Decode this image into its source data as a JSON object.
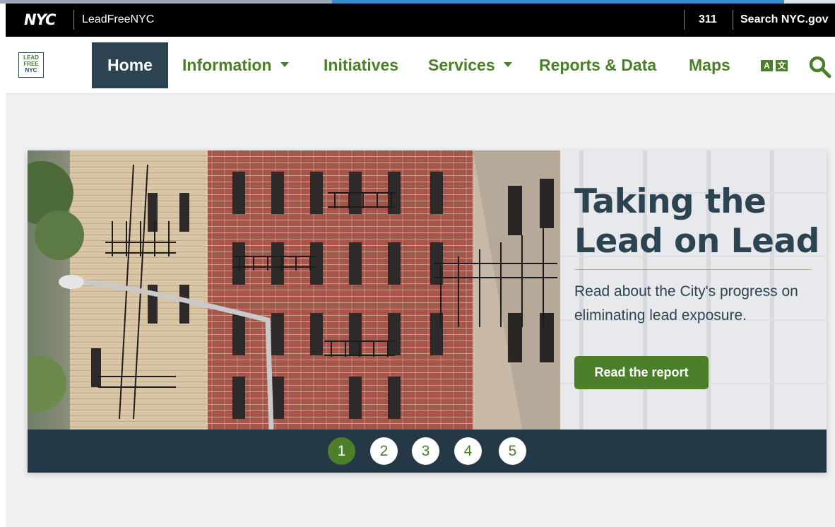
{
  "nyc_bar": {
    "logo": "NYC",
    "site_name": "LeadFreeNYC",
    "link_311": "311",
    "search_link": "Search NYC.gov"
  },
  "nav": {
    "logo_lines": [
      "LEAD",
      "FREE",
      "NYC"
    ],
    "items": [
      {
        "label": "Home",
        "active": true,
        "dropdown": false
      },
      {
        "label": "Information",
        "active": false,
        "dropdown": true
      },
      {
        "label": "Initiatives",
        "active": false,
        "dropdown": false
      },
      {
        "label": "Services",
        "active": false,
        "dropdown": true
      },
      {
        "label": "Reports & Data",
        "active": false,
        "dropdown": false
      },
      {
        "label": "Maps",
        "active": false,
        "dropdown": false
      }
    ],
    "translate_icon": "translate-icon",
    "search_icon": "search-icon"
  },
  "hero": {
    "heading": "Taking the Lead on Lead",
    "text": "Read about the City's progress on eliminating lead exposure.",
    "button": "Read the report",
    "image_alt_icon": "building-facade-photo",
    "pager": [
      "1",
      "2",
      "3",
      "4",
      "5"
    ],
    "active_page": "1"
  },
  "colors": {
    "brand_green": "#4b7f2a",
    "brand_navy": "#2c4351",
    "pager_bg": "#243845"
  }
}
